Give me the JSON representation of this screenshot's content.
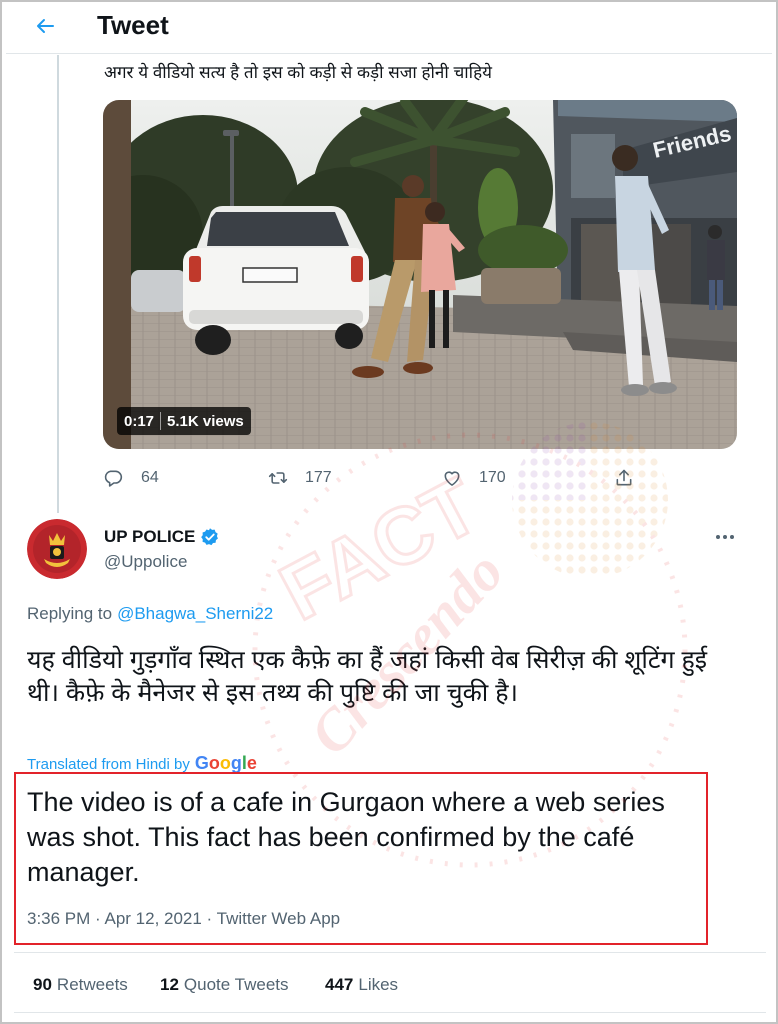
{
  "colors": {
    "text": "#0f1419",
    "secondary_text": "#536471",
    "accent": "#1d9bf0",
    "highlight_box": "#e2232a",
    "divider": "#e1e6e9"
  },
  "header": {
    "back_icon": "arrow-left-icon",
    "title": "Tweet"
  },
  "parent_tweet": {
    "text": "अगर ये वीडियो सत्य है तो इस को कड़ी से कड़ी सजा होनी चाहिये",
    "video": {
      "duration": "0:17",
      "views": "5.1K views",
      "sign_text": "Friends"
    },
    "actions": {
      "reply": {
        "icon": "reply-icon",
        "count": "64"
      },
      "retweet": {
        "icon": "retweet-icon",
        "count": "177"
      },
      "like": {
        "icon": "heart-icon",
        "count": "170"
      },
      "share": {
        "icon": "share-icon"
      }
    }
  },
  "tweet": {
    "author": {
      "name": "UP POLICE",
      "handle": "@Uppolice",
      "verified": true,
      "verified_icon": "verified-badge-icon",
      "more_icon": "more-icon"
    },
    "replying_prefix": "Replying to",
    "replying_to": "@Bhagwa_Sherni22",
    "text": "यह वीडियो गुड़गाँव स्थित एक कैफ़े का हैं जहां किसी वेब सिरीज़ की शूटिंग हुई थी। कैफ़े के मैनेजर से इस तथ्य की पुष्टि की जा चुकी है।",
    "translated_prefix": "Translated from Hindi by",
    "translated_by": "Google",
    "google_letter_colors": [
      "#4285f4",
      "#ea4335",
      "#fbbc05",
      "#4285f4",
      "#34a853",
      "#ea4335"
    ],
    "translation": "The video is of a cafe in Gurgaon where a web series was shot. This fact has been confirmed by the café manager.",
    "meta": "3:36 PM · Apr 12, 2021 · Twitter Web App"
  },
  "stats": [
    {
      "count": "90",
      "label": "Retweets"
    },
    {
      "count": "12",
      "label": "Quote Tweets"
    },
    {
      "count": "447",
      "label": "Likes"
    }
  ],
  "watermark": {
    "lines": [
      "FACT",
      "Crescendo"
    ]
  }
}
